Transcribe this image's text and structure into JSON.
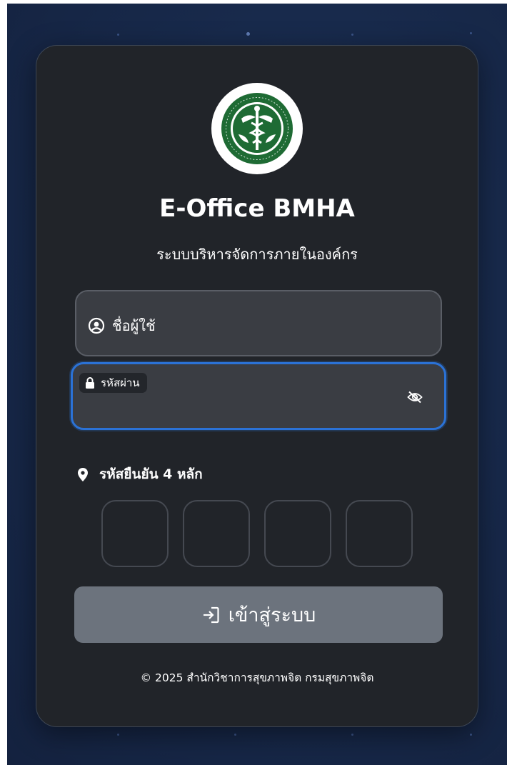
{
  "app": {
    "title": "E-Office BMHA",
    "subtitle": "ระบบบริหารจัดการภายในองค์กร"
  },
  "logo": {
    "icon": "ministry-of-public-health-seal"
  },
  "username": {
    "placeholder": "ชื่อผู้ใช้",
    "value": "",
    "icon": "user-circle-icon"
  },
  "password": {
    "label": "รหัสผ่าน",
    "value": "",
    "icon": "lock-icon",
    "toggle_icon": "eye-slash-icon"
  },
  "otp": {
    "label": "รหัสยืนยัน 4 หลัก",
    "icon": "map-pin-icon",
    "digits": [
      "",
      "",
      "",
      ""
    ]
  },
  "login_button": {
    "label": "เข้าสู่ระบบ",
    "icon": "sign-in-icon"
  },
  "footer": {
    "text": "© 2025 สำนักวิชาการสุขภาพจิต กรมสุขภาพจิต"
  },
  "colors": {
    "background": "#182a4c",
    "card": "#212429",
    "input": "#3a3d43",
    "focus_border": "#2b72d6",
    "button": "#6c737d",
    "logo_green": "#1e6b34"
  }
}
